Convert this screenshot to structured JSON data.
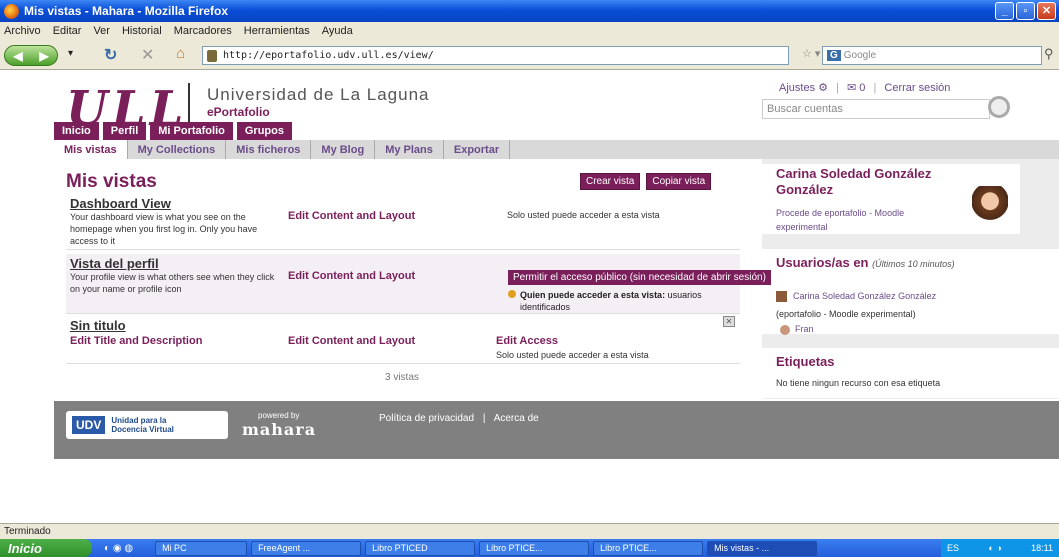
{
  "window": {
    "title": "Mis vistas - Mahara - Mozilla Firefox"
  },
  "menu": [
    "Archivo",
    "Editar",
    "Ver",
    "Historial",
    "Marcadores",
    "Herramientas",
    "Ayuda"
  ],
  "browser": {
    "url": "http://eportafolio.udv.ull.es/view/",
    "search_placeholder": "Google"
  },
  "site": {
    "logo": "ULL",
    "university": "Universidad de La Laguna",
    "product": "ePortafolio"
  },
  "userlinks": {
    "settings": "Ajustes",
    "messages": "0",
    "logout": "Cerrar sesión"
  },
  "search": {
    "placeholder": "Buscar cuentas"
  },
  "main_tabs": [
    "Inicio",
    "Perfil",
    "Mi Portafolio",
    "Grupos"
  ],
  "sub_tabs": [
    "Mis vistas",
    "My Collections",
    "Mis ficheros",
    "My Blog",
    "My Plans",
    "Exportar"
  ],
  "page": {
    "title": "Mis vistas",
    "create_view": "Crear vista",
    "copy_view": "Copiar vista",
    "count": "3 vistas"
  },
  "views": [
    {
      "title": "Dashboard View",
      "desc": "Your dashboard view is what you see on the homepage when you first log in. Only you have access to it",
      "edit": "Edit Content and Layout",
      "access": "Solo usted puede acceder a esta vista"
    },
    {
      "title": "Vista del perfil",
      "desc": "Your profile view is what others see when they click on your name or profile icon",
      "edit": "Edit Content and Layout",
      "access_button": "Permitir el acceso público (sin necesidad de abrir sesión)",
      "access_label": "Quien puede acceder a esta vista:",
      "access_value": "usuarios identificados"
    },
    {
      "title": "Sin titulo",
      "edit_title": "Edit Title and Description",
      "edit": "Edit Content and Layout",
      "edit_access": "Edit Access",
      "access": "Solo usted puede acceder a esta vista"
    }
  ],
  "sidebar": {
    "user_name": "Carina Soledad González González",
    "user_source": "Procede de eportafolio - Moodle experimental",
    "online_title": "Usuarios/as en",
    "online_subtitle": "(Últimos 10 minutos)",
    "online_users": [
      "Carina Soledad González González",
      "(eportafolio - Moodle experimental)",
      "Fran"
    ],
    "tags_title": "Etiquetas",
    "tags_text": "No tiene ningun recurso con esa etiqueta"
  },
  "footer": {
    "udv_line1": "Unidad para la",
    "udv_line2": "Docencia Virtual",
    "powered": "powered by",
    "mahara": "mahara",
    "privacy": "Política de privacidad",
    "about": "Acerca de"
  },
  "status": "Terminado",
  "taskbar": {
    "start": "Inicio",
    "tasks": [
      "Mi PC",
      "FreeAgent ...",
      "Libro PTICED",
      "Libro PTICE...",
      "Libro PTICE...",
      "Mis vistas - ..."
    ],
    "lang": "ES",
    "time": "18:11"
  }
}
